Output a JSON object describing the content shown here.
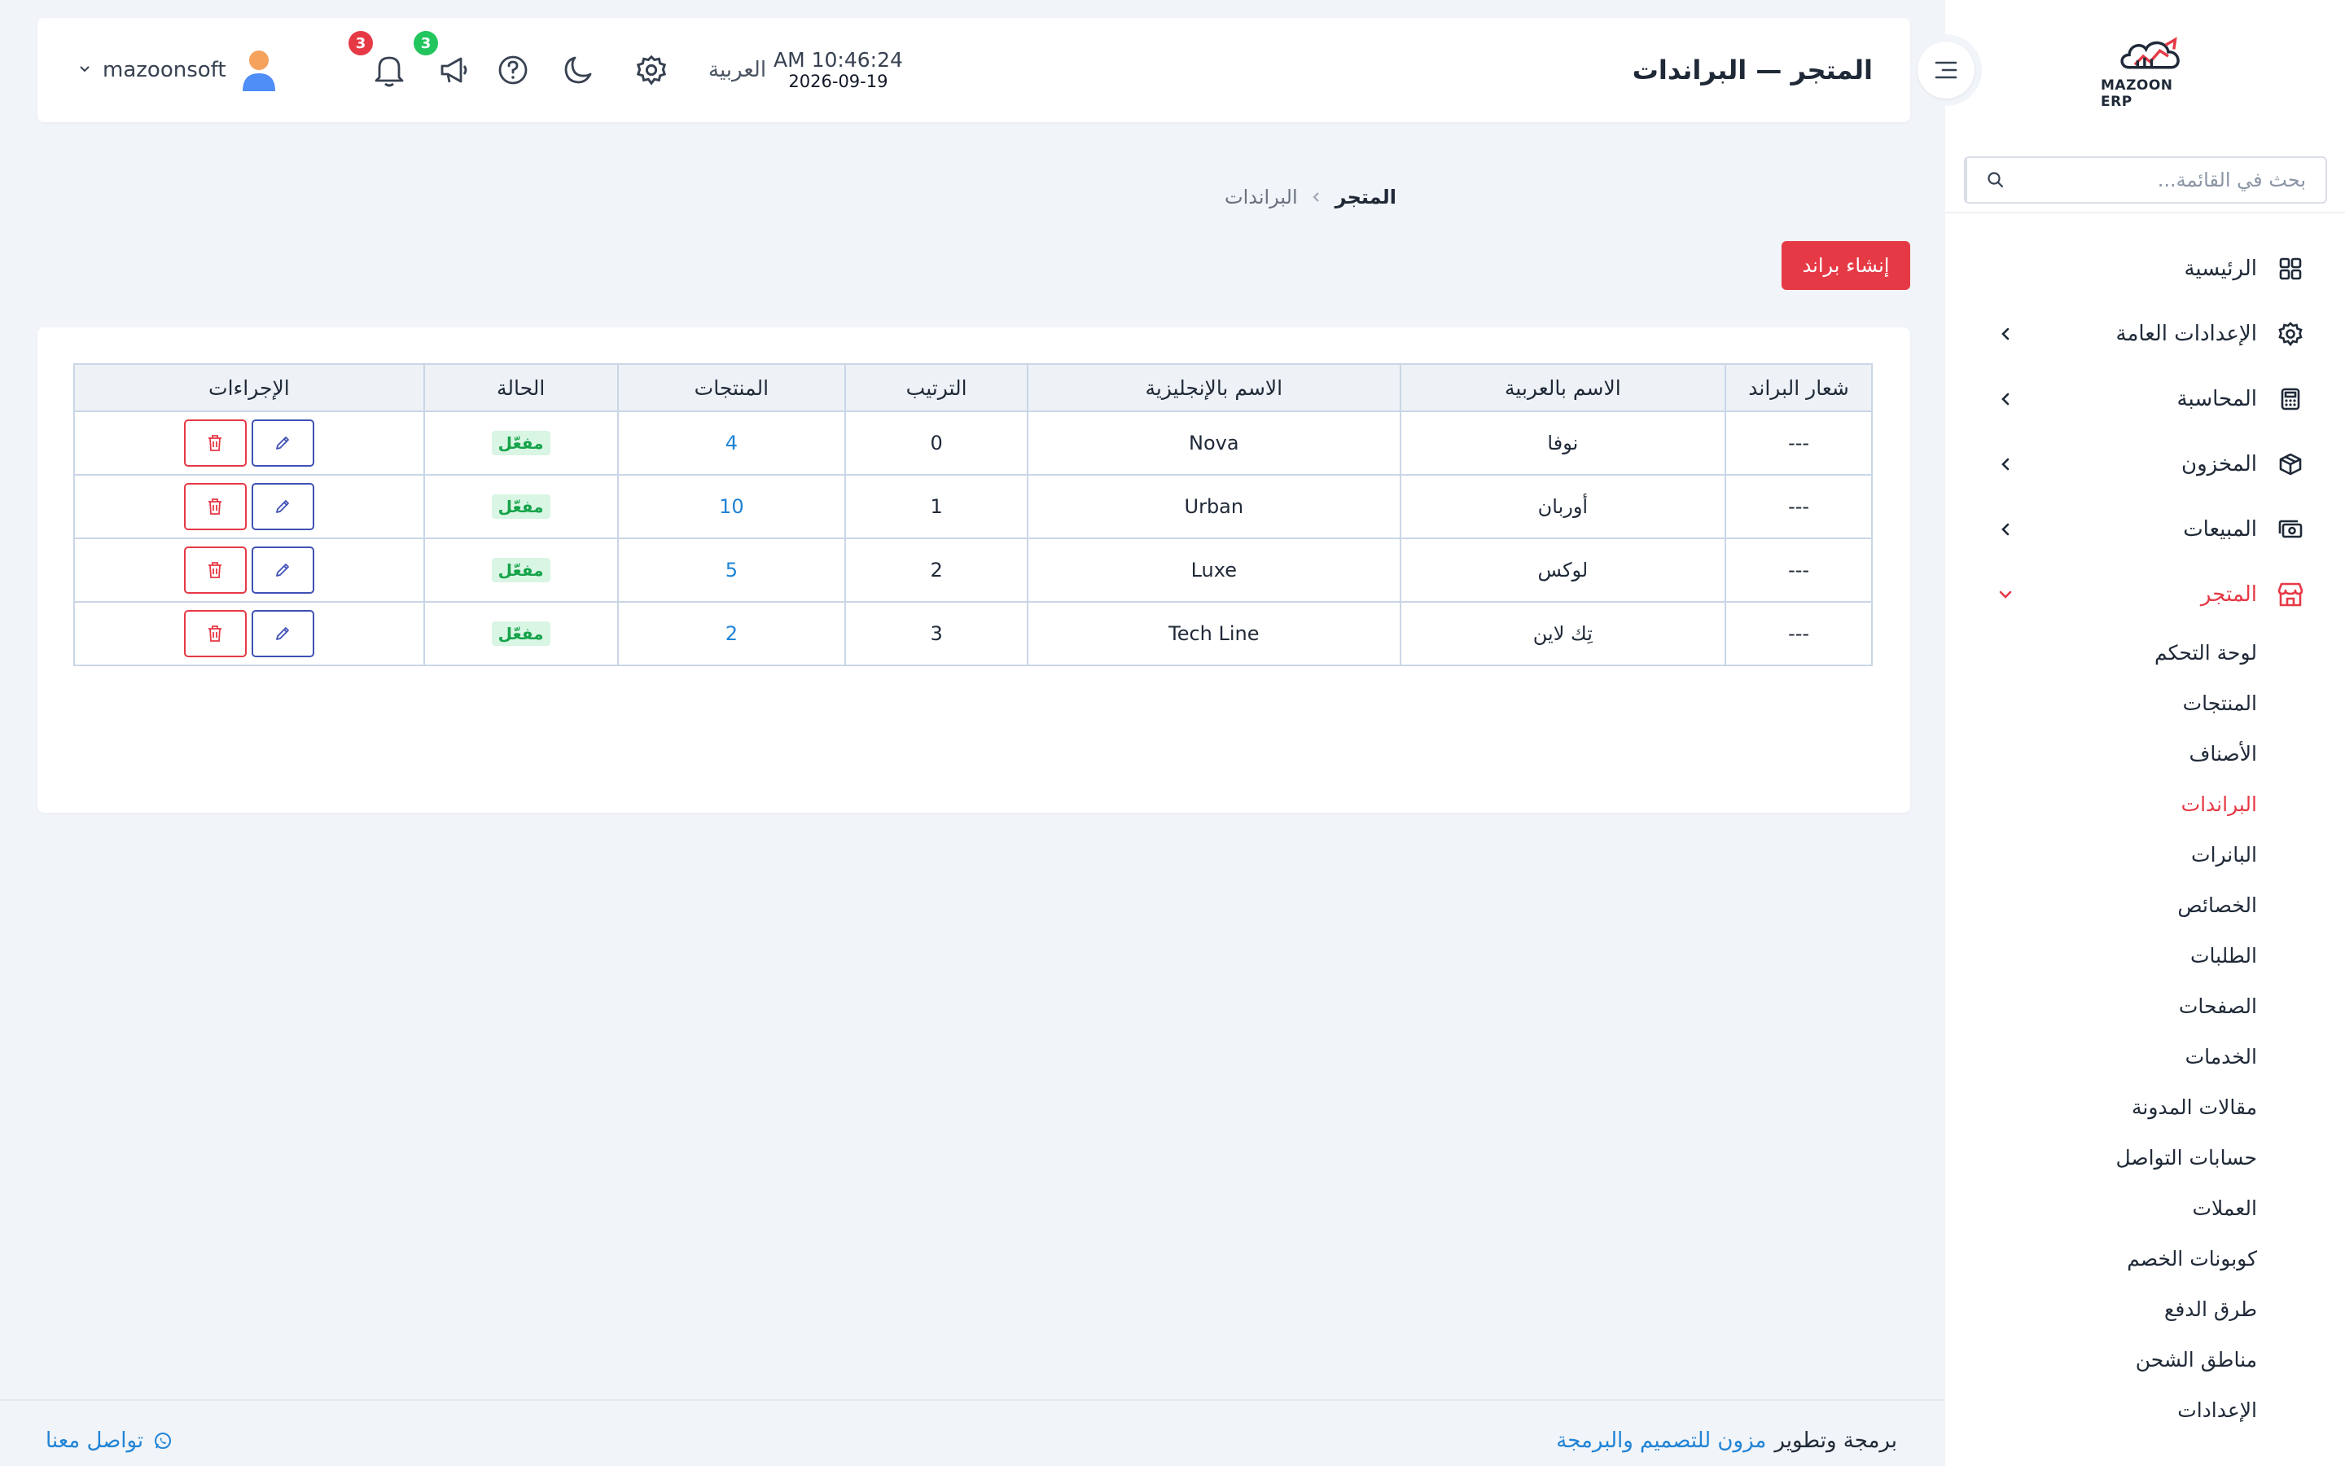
{
  "sidebar": {
    "logo_text": "MAZOON ERP",
    "search_placeholder": "بحث في القائمة...",
    "items": [
      {
        "label": "الرئيسية",
        "icon": "grid-icon",
        "has_children": false
      },
      {
        "label": "الإعدادات العامة",
        "icon": "gear-icon",
        "has_children": true
      },
      {
        "label": "المحاسبة",
        "icon": "calculator-icon",
        "has_children": true
      },
      {
        "label": "المخزون",
        "icon": "box-icon",
        "has_children": true
      },
      {
        "label": "المبيعات",
        "icon": "cash-icon",
        "has_children": true
      },
      {
        "label": "المتجر",
        "icon": "store-icon",
        "has_children": true,
        "active": true
      }
    ],
    "store_submenu": [
      "لوحة التحكم",
      "المنتجات",
      "الأصناف",
      "البراندات",
      "البانرات",
      "الخصائص",
      "الطلبات",
      "الصفحات",
      "الخدمات",
      "مقالات المدونة",
      "حسابات التواصل",
      "العملات",
      "كوبونات الخصم",
      "طرق الدفع",
      "مناطق الشحن",
      "الإعدادات"
    ],
    "active_submenu": "البراندات"
  },
  "header": {
    "title": "المتجر — البراندات",
    "user_name": "mazoonsoft",
    "notifications_count": "3",
    "announcements_count": "3",
    "language": "العربية",
    "time": "AM 10:46:24",
    "date": "2026-09-19"
  },
  "breadcrumb": {
    "root": "المتجر",
    "current": "البراندات"
  },
  "create_button": "إنشاء براند",
  "table": {
    "headers": [
      "شعار البراند",
      "الاسم بالعربية",
      "الاسم بالإنجليزية",
      "الترتيب",
      "المنتجات",
      "الحالة",
      "الإجراءات"
    ],
    "rows": [
      {
        "logo": "---",
        "name_ar": "نوفا",
        "name_en": "Nova",
        "order": "0",
        "products": "4",
        "status": "مفعّل"
      },
      {
        "logo": "---",
        "name_ar": "أوربان",
        "name_en": "Urban",
        "order": "1",
        "products": "10",
        "status": "مفعّل"
      },
      {
        "logo": "---",
        "name_ar": "لوكس",
        "name_en": "Luxe",
        "order": "2",
        "products": "5",
        "status": "مفعّل"
      },
      {
        "logo": "---",
        "name_ar": "تِك لاين",
        "name_en": "Tech Line",
        "order": "3",
        "products": "2",
        "status": "مفعّل"
      }
    ]
  },
  "footer": {
    "credit_prefix": "برمجة وتطوير",
    "credit_link": "مزون للتصميم والبرمجة",
    "contact": "تواصل معنا"
  },
  "colors": {
    "accent": "#e63946",
    "link": "#1f83d6",
    "success": "#16a34a",
    "success_bg": "#d9f5e3",
    "edit": "#3f51b5",
    "badge_green": "#22c55e"
  }
}
